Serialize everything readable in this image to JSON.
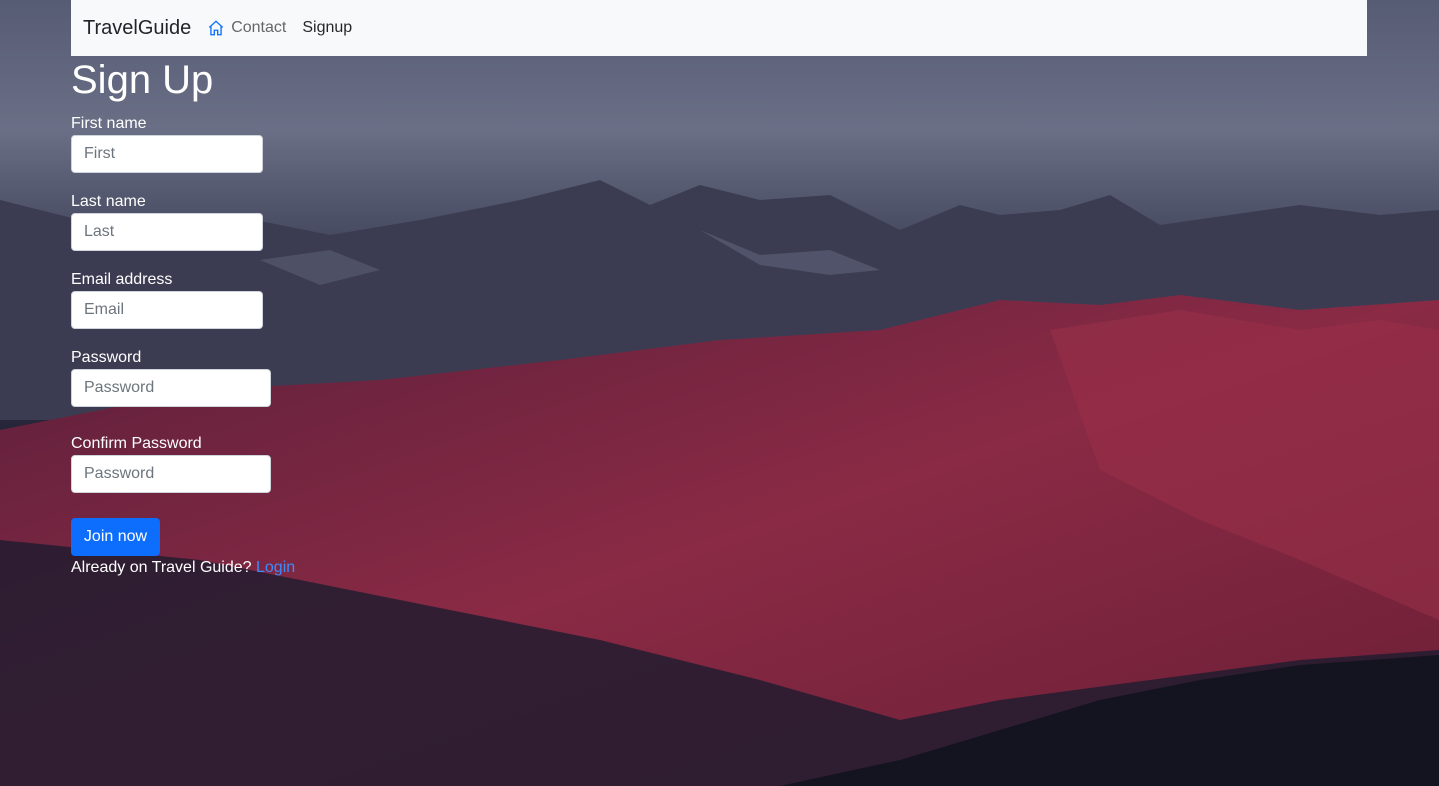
{
  "navbar": {
    "brand": "TravelGuide",
    "home_icon": "home-icon",
    "links": [
      "Contact",
      "Signup"
    ]
  },
  "form": {
    "title": "Sign Up",
    "first_name": {
      "label": "First name",
      "placeholder": "First"
    },
    "last_name": {
      "label": "Last name",
      "placeholder": "Last"
    },
    "email": {
      "label": "Email address",
      "placeholder": "Email"
    },
    "password": {
      "label": "Password",
      "placeholder": "Password"
    },
    "confirm_password": {
      "label": "Confirm Password",
      "placeholder": "Password"
    },
    "submit_label": "Join now",
    "already_text": "Already on Travel Guide? ",
    "login_link": "Login"
  },
  "colors": {
    "primary": "#0d6efd",
    "link": "#3d8bfd",
    "navbar_bg": "#f8f9fa"
  }
}
